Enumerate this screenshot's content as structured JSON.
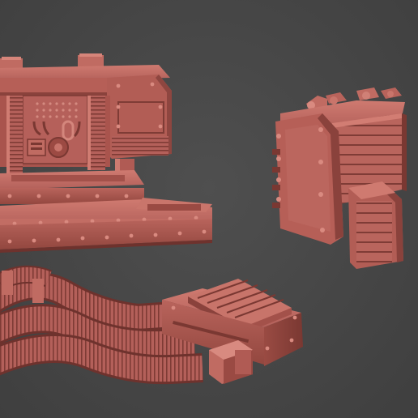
{
  "scene": {
    "background_color": "#474747",
    "model_color": "#b8625a",
    "model_shadow_color": "#7a3a34",
    "model_highlight_color": "#d27d73",
    "objects": [
      "industrial-machine-block",
      "armored-bulkhead-crate",
      "pipe-bundle-with-connector"
    ]
  }
}
